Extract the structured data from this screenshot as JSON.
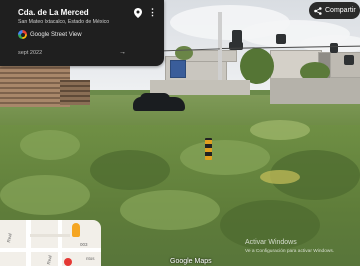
{
  "info_card": {
    "title": "Cda. de La Merced",
    "subtitle": "San Mateo Ixtacalco, Estado de México",
    "source": "Google Street View",
    "date": "sept 2022",
    "icons": {
      "pin": "place-pin-icon",
      "more": "more-vert-icon",
      "expand": "arrow-icon"
    }
  },
  "share": {
    "label": "Compartir",
    "icon": "share-icon"
  },
  "minimap": {
    "labels": [
      "Real",
      "003",
      "Real",
      "ntos"
    ]
  },
  "watermark": "Google Maps",
  "activate": {
    "title": "Activar Windows",
    "subtitle": "Ve a Configuración para activar Windows."
  }
}
